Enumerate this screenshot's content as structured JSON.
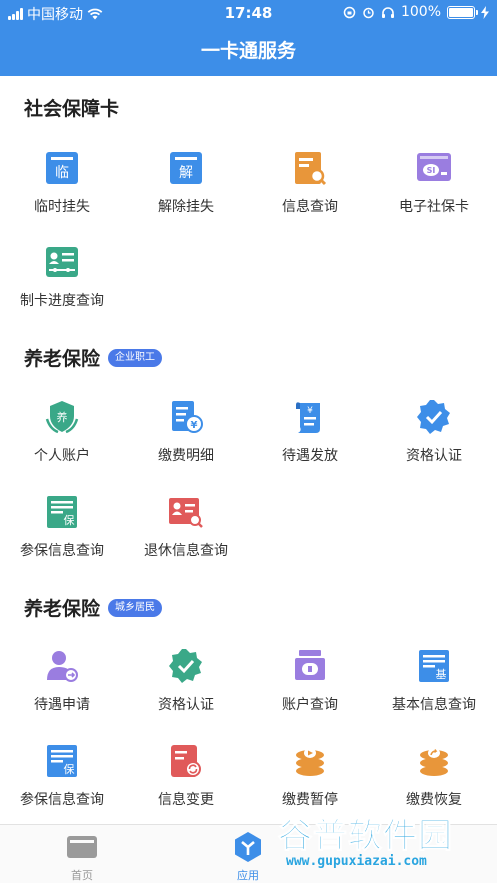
{
  "status_bar": {
    "carrier": "中国移动",
    "time": "17:48",
    "battery": "100%"
  },
  "header": {
    "title": "一卡通服务"
  },
  "sections": [
    {
      "title": "社会保障卡",
      "tag": "",
      "items": [
        {
          "label": "临时挂失",
          "icon": "temporary-loss-report-icon",
          "glyph": "临"
        },
        {
          "label": "解除挂失",
          "icon": "cancel-loss-report-icon",
          "glyph": "解"
        },
        {
          "label": "信息查询",
          "icon": "info-query-icon"
        },
        {
          "label": "电子社保卡",
          "icon": "electronic-social-security-card-icon"
        },
        {
          "label": "制卡进度查询",
          "icon": "card-progress-query-icon"
        }
      ]
    },
    {
      "title": "养老保险",
      "tag": "企业职工",
      "items": [
        {
          "label": "个人账户",
          "icon": "personal-account-icon",
          "glyph": "养"
        },
        {
          "label": "缴费明细",
          "icon": "payment-details-icon"
        },
        {
          "label": "待遇发放",
          "icon": "benefit-payment-icon"
        },
        {
          "label": "资格认证",
          "icon": "qualification-certification-icon"
        },
        {
          "label": "参保信息查询",
          "icon": "insured-info-query-icon",
          "glyph": "保"
        },
        {
          "label": "退休信息查询",
          "icon": "retirement-info-query-icon"
        }
      ]
    },
    {
      "title": "养老保险",
      "tag": "城乡居民",
      "items": [
        {
          "label": "待遇申请",
          "icon": "benefit-application-icon"
        },
        {
          "label": "资格认证",
          "icon": "qualification-certification-icon"
        },
        {
          "label": "账户查询",
          "icon": "account-query-icon"
        },
        {
          "label": "基本信息查询",
          "icon": "basic-info-query-icon",
          "glyph": "基"
        },
        {
          "label": "参保信息查询",
          "icon": "insured-info-query-icon",
          "glyph": "保"
        },
        {
          "label": "信息变更",
          "icon": "info-change-icon"
        },
        {
          "label": "缴费暂停",
          "icon": "payment-suspend-icon"
        },
        {
          "label": "缴费恢复",
          "icon": "payment-resume-icon"
        }
      ]
    }
  ],
  "tabbar": [
    {
      "label": "首页",
      "icon": "home-card-icon",
      "active": false
    },
    {
      "label": "应用",
      "icon": "apps-icon",
      "active": true
    }
  ],
  "watermark": {
    "text": "谷普软件园",
    "url": "www.gupuxiazai.com"
  },
  "colors": {
    "primary": "#3d8ee8",
    "tab_active": "#3d8ee8",
    "tab_inactive": "#999999",
    "tag": "#4a79e8"
  }
}
